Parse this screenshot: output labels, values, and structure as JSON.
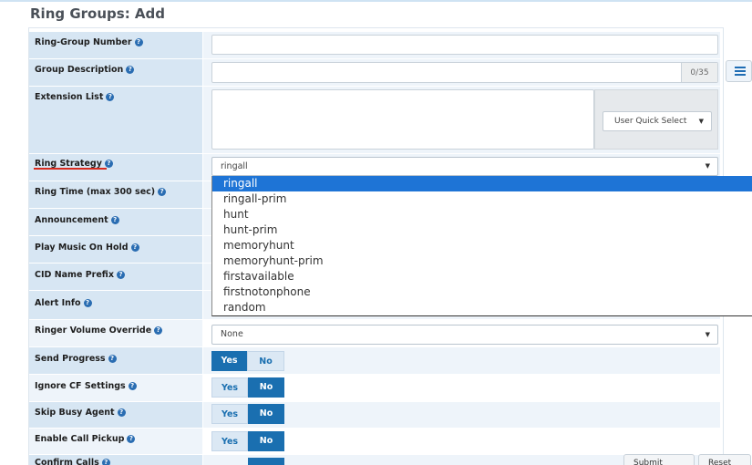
{
  "page_title": "Ring Groups: Add",
  "help_glyph": "?",
  "fields": {
    "ring_group_number": {
      "label": "Ring-Group Number"
    },
    "group_description": {
      "label": "Group Description",
      "counter": "0/35"
    },
    "extension_list": {
      "label": "Extension List",
      "quick_select": "User Quick Select"
    },
    "ring_strategy": {
      "label": "Ring Strategy",
      "value": "ringall"
    },
    "ring_time": {
      "label": "Ring Time (max 300 sec)"
    },
    "announcement": {
      "label": "Announcement"
    },
    "play_music_on_hold": {
      "label": "Play Music On Hold"
    },
    "cid_name_prefix": {
      "label": "CID Name Prefix"
    },
    "alert_info": {
      "label": "Alert Info"
    },
    "ringer_volume_override": {
      "label": "Ringer Volume Override",
      "value": "None"
    },
    "send_progress": {
      "label": "Send Progress",
      "selected": "Yes"
    },
    "ignore_cf_settings": {
      "label": "Ignore CF Settings",
      "selected": "No"
    },
    "skip_busy_agent": {
      "label": "Skip Busy Agent",
      "selected": "No"
    },
    "enable_call_pickup": {
      "label": "Enable Call Pickup",
      "selected": "No"
    },
    "confirm_calls": {
      "label": "Confirm Calls"
    }
  },
  "toggle_labels": {
    "yes": "Yes",
    "no": "No"
  },
  "dropdown_options": [
    "ringall",
    "ringall-prim",
    "hunt",
    "hunt-prim",
    "memoryhunt",
    "memoryhunt-prim",
    "firstavailable",
    "firstnotonphone",
    "random"
  ],
  "dropdown_selected": "ringall",
  "bottom_buttons": [
    "Submit",
    "Reset"
  ],
  "colors": {
    "accent": "#1a6fb0",
    "label_bg": "#d7e6f3",
    "highlight": "#1e74d6",
    "underline": "#d72b1f"
  }
}
